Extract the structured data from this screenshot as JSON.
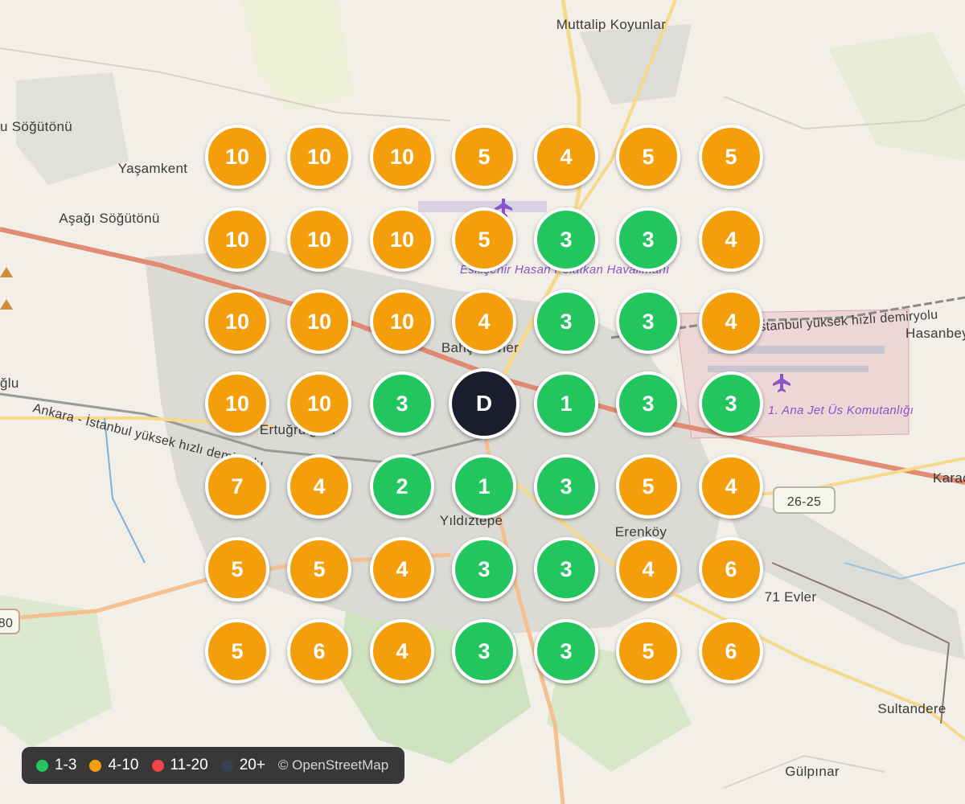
{
  "map": {
    "places": [
      {
        "key": "muttalip",
        "text": "Muttalip Koyunlar"
      },
      {
        "key": "sogutonu",
        "text": "u Söğütönü"
      },
      {
        "key": "yasamkent",
        "text": "Yaşamkent"
      },
      {
        "key": "asagi",
        "text": "Aşağı Söğütönü"
      },
      {
        "key": "hasanbey",
        "text": "Hasanbey"
      },
      {
        "key": "oglu",
        "text": "ğlu"
      },
      {
        "key": "ertugrulgazi",
        "text": "Ertuğrulgazi"
      },
      {
        "key": "bahcelievler",
        "text": "Bahçelievler"
      },
      {
        "key": "yildiztepe",
        "text": "Yıldıztepe"
      },
      {
        "key": "erenkoy",
        "text": "Erenköy"
      },
      {
        "key": "yetmisbirevler",
        "text": "71 Evler"
      },
      {
        "key": "karaca",
        "text": "Karac"
      },
      {
        "key": "sultandere",
        "text": "Sultandere"
      },
      {
        "key": "gulpinar",
        "text": "Gülpınar"
      },
      {
        "key": "railway1",
        "text": "İstanbul yüksek hızlı demiryolu"
      },
      {
        "key": "railway2",
        "text": "Ankara - İstanbul yüksek hızlı demiryolu"
      },
      {
        "key": "anakomutanligi",
        "text": "1. Ana Jet Üs Komutanlığı"
      },
      {
        "key": "airport",
        "text": "Eskişehir Hasan Polatkan Havalimanı"
      },
      {
        "key": "road",
        "text": "26-25"
      },
      {
        "key": "road80",
        "text": "80"
      }
    ]
  },
  "grid": {
    "rows": [
      [
        "10",
        "10",
        "10",
        "5",
        "4",
        "5",
        "5"
      ],
      [
        "10",
        "10",
        "10",
        "5",
        "3",
        "3",
        "4"
      ],
      [
        "10",
        "10",
        "10",
        "4",
        "3",
        "3",
        "4"
      ],
      [
        "10",
        "10",
        "3",
        "D",
        "1",
        "3",
        "3"
      ],
      [
        "7",
        "4",
        "2",
        "1",
        "3",
        "5",
        "4"
      ],
      [
        "5",
        "5",
        "4",
        "3",
        "3",
        "4",
        "6"
      ],
      [
        "5",
        "6",
        "4",
        "3",
        "3",
        "5",
        "6"
      ]
    ],
    "center_label": "D"
  },
  "legend": {
    "items": [
      {
        "label": "1-3",
        "color": "#22c55e"
      },
      {
        "label": "4-10",
        "color": "#f59e0b"
      },
      {
        "label": "11-20",
        "color": "#ef4444"
      },
      {
        "label": "20+",
        "color": "#374151"
      }
    ],
    "attribution": "© OpenStreetMap"
  },
  "colors": {
    "green": "#22c55e",
    "orange": "#f59e0b",
    "red": "#ef4444",
    "dark": "#1a1d2e"
  }
}
